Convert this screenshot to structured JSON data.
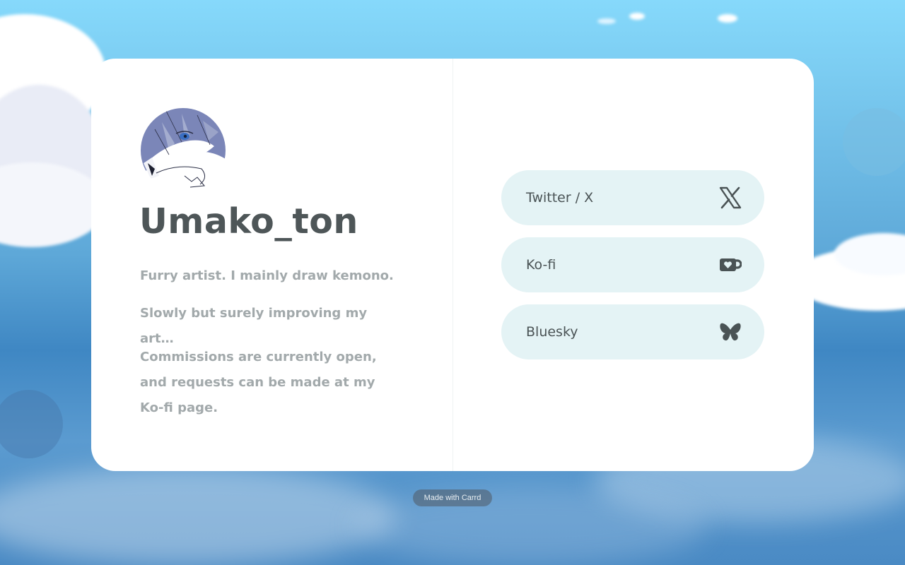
{
  "profile": {
    "name": "Umako_ton",
    "bio": [
      "Furry artist. I mainly draw kemono.",
      "Slowly but surely improving my art…",
      "Commissions are currently open, and requests can be made at my Ko-fi page."
    ]
  },
  "links": [
    {
      "label": "Twitter / X",
      "icon": "x-logo-icon"
    },
    {
      "label": "Ko-fi",
      "icon": "kofi-cup-icon"
    },
    {
      "label": "Bluesky",
      "icon": "bluesky-butterfly-icon"
    }
  ],
  "footer": {
    "credit": "Made with Carrd"
  },
  "colors": {
    "card_bg": "#ffffff",
    "button_bg": "#e4f3f5",
    "name_text": "#4e5658",
    "bio_text": "#a2a9ab",
    "icon_color": "#4a5355",
    "sky": "#86d9fb"
  }
}
